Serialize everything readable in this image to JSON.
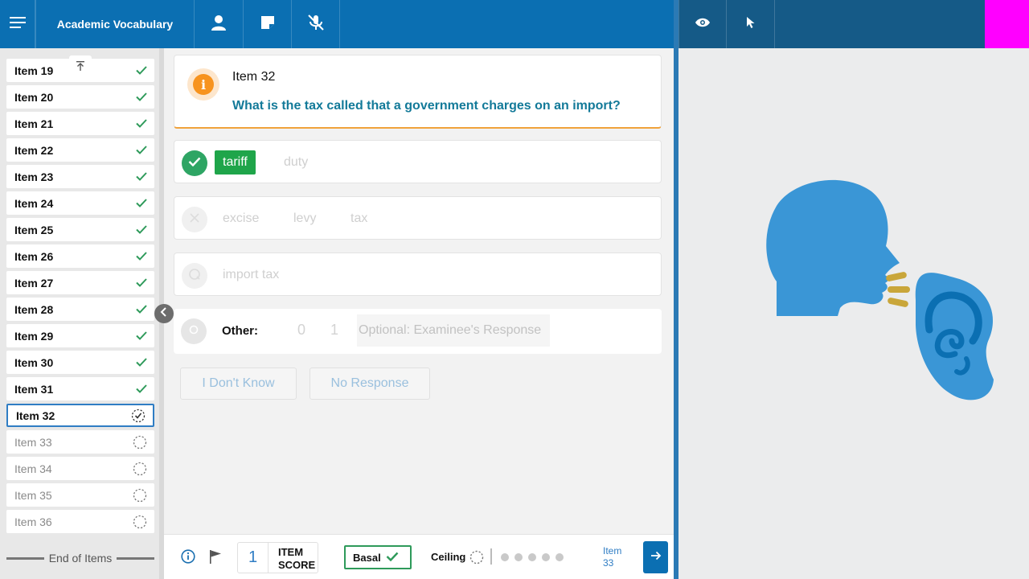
{
  "header": {
    "title": "Academic Vocabulary",
    "icons": [
      "menu-icon",
      "person-icon",
      "note-icon",
      "mic-off-icon",
      "eye-icon",
      "pointer-icon"
    ],
    "accent_color": "#0b6fb2",
    "right_bar_color": "#155a87",
    "corner_color": "#ff00ff"
  },
  "sidebar": {
    "items": [
      {
        "label": "Item 19",
        "status": "done"
      },
      {
        "label": "Item 20",
        "status": "done"
      },
      {
        "label": "Item 21",
        "status": "done"
      },
      {
        "label": "Item 22",
        "status": "done"
      },
      {
        "label": "Item 23",
        "status": "done"
      },
      {
        "label": "Item 24",
        "status": "done"
      },
      {
        "label": "Item 25",
        "status": "done"
      },
      {
        "label": "Item 26",
        "status": "done"
      },
      {
        "label": "Item 27",
        "status": "done"
      },
      {
        "label": "Item 28",
        "status": "done"
      },
      {
        "label": "Item 29",
        "status": "done"
      },
      {
        "label": "Item 30",
        "status": "done"
      },
      {
        "label": "Item 31",
        "status": "done"
      },
      {
        "label": "Item 32",
        "status": "current"
      },
      {
        "label": "Item 33",
        "status": "pending"
      },
      {
        "label": "Item 34",
        "status": "pending"
      },
      {
        "label": "Item 35",
        "status": "pending"
      },
      {
        "label": "Item 36",
        "status": "pending"
      }
    ],
    "end_label": "End of Items"
  },
  "question": {
    "title": "Item 32",
    "text": "What is the tax called that a government charges on an import?"
  },
  "options": {
    "correct": {
      "words": [
        "tariff",
        "duty"
      ],
      "selected": "tariff"
    },
    "incorrect": {
      "words": [
        "excise",
        "levy",
        "tax"
      ]
    },
    "query": {
      "words": [
        "import tax"
      ]
    },
    "other": {
      "label": "Other:",
      "score_0": "0",
      "score_1": "1",
      "placeholder": "Optional: Examinee's Response"
    }
  },
  "buttons": {
    "dont_know": "I Don't Know",
    "no_response": "No Response"
  },
  "footer": {
    "item_score_value": "1",
    "item_score_line1": "ITEM",
    "item_score_line2": "SCORE",
    "basal_label": "Basal",
    "ceiling_label": "Ceiling",
    "ceiling_dots": 5,
    "next_label_line1": "Item",
    "next_label_line2": "33"
  },
  "colors": {
    "correct_green": "#1fa54a",
    "info_orange": "#f7931e",
    "question_teal": "#137a99",
    "head_blue": "#3a96d6",
    "sound_gold": "#c9a63a"
  }
}
